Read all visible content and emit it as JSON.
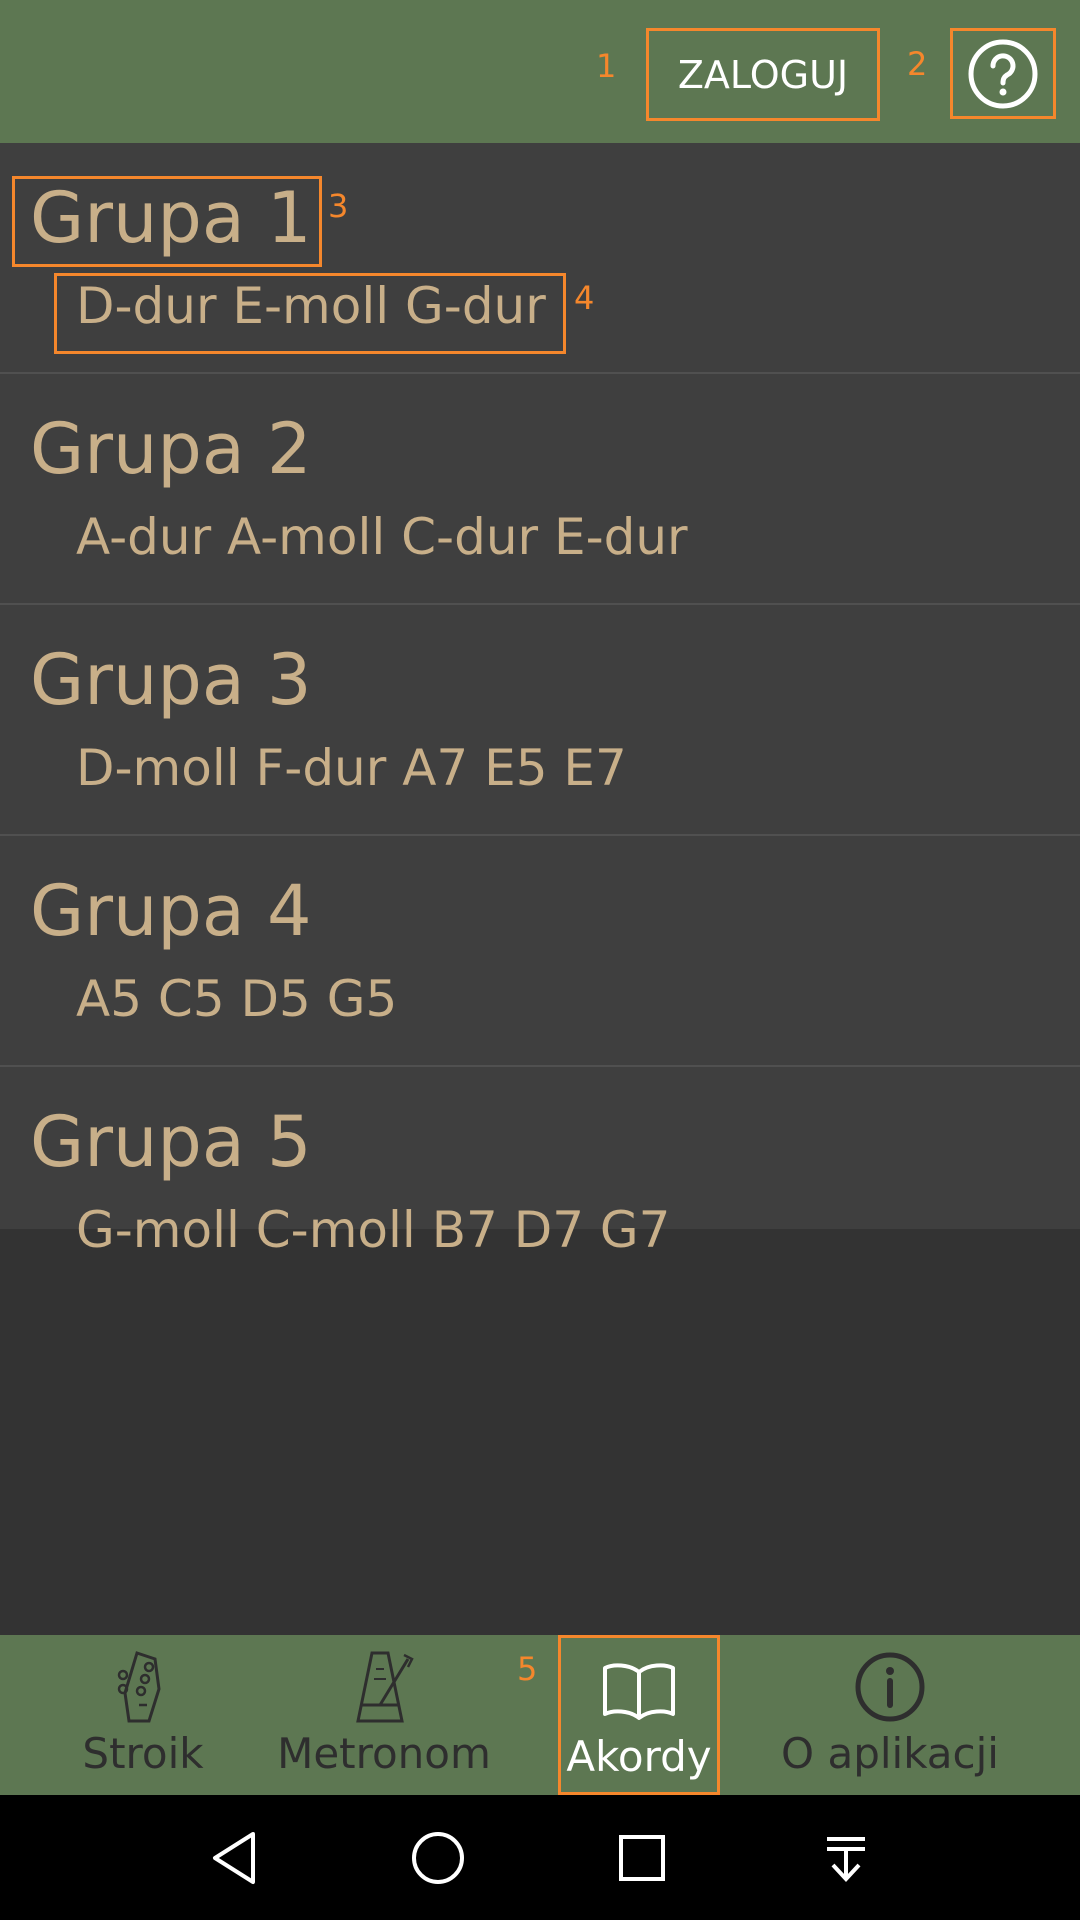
{
  "topbar": {
    "login_label": "ZALOGUJ",
    "help_icon": "help-circle-icon",
    "anno_login": "1",
    "anno_help": "2"
  },
  "groups": [
    {
      "title": "Grupa 1",
      "chords": "D-dur E-moll G-dur"
    },
    {
      "title": "Grupa 2",
      "chords": "A-dur A-moll C-dur E-dur"
    },
    {
      "title": "Grupa 3",
      "chords": "D-moll F-dur A7 E5 E7"
    },
    {
      "title": "Grupa 4",
      "chords": "A5 C5 D5 G5"
    },
    {
      "title": "Grupa 5",
      "chords": "G-moll C-moll B7 D7 G7"
    }
  ],
  "annotations": {
    "group_title": "3",
    "group_chords": "4",
    "nav_akordy": "5"
  },
  "nav": {
    "items": [
      {
        "label": "Stroik",
        "icon": "guitar-headstock-icon"
      },
      {
        "label": "Metronom",
        "icon": "metronome-icon"
      },
      {
        "label": "Akordy",
        "icon": "open-book-icon",
        "active": true
      },
      {
        "label": "O aplikacji",
        "icon": "info-icon"
      }
    ]
  },
  "system_nav": {
    "icons": [
      "back-icon",
      "home-icon",
      "recents-icon",
      "notification-pull-icon"
    ]
  },
  "colors": {
    "bar_green": "#5d7752",
    "background": "#333333",
    "list_item": "#3f3f3f",
    "text_tan": "#c8af89",
    "highlight_orange": "#f5872c"
  }
}
